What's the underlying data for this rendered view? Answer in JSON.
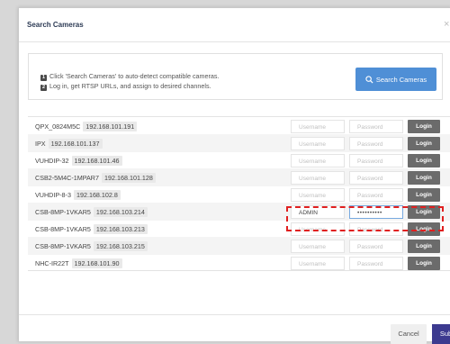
{
  "dialog": {
    "title": "Search Cameras",
    "close_label": "×",
    "steps": [
      {
        "num": "1",
        "text": "Click 'Search Cameras' to auto-detect compatible cameras."
      },
      {
        "num": "2",
        "text": "Log in, get RTSP URLs, and assign to desired channels."
      }
    ],
    "search_button_label": "Search Cameras",
    "search_icon": "search-icon",
    "cancel_label": "Cancel",
    "submit_label": "Submit"
  },
  "fields": {
    "username_placeholder": "Username",
    "password_placeholder": "Password",
    "login_label": "Login"
  },
  "cameras": [
    {
      "name": "QPX_0824M5C",
      "ip": "192.168.101.191"
    },
    {
      "name": "IPX",
      "ip": "192.168.101.137"
    },
    {
      "name": "VUHDIP-32",
      "ip": "192.168.101.46"
    },
    {
      "name": "CSB2-5M4C-1MPAR7",
      "ip": "192.168.101.128"
    },
    {
      "name": "VUHDIP-8-3",
      "ip": "192.168.102.8"
    },
    {
      "name": "CSB-8MP-1VKAR5",
      "ip": "192.168.103.214",
      "username": "ADMIN",
      "password": "••••••••••"
    },
    {
      "name": "CSB-8MP-1VKAR5",
      "ip": "192.168.103.213"
    },
    {
      "name": "CSB-8MP-1VKAR5",
      "ip": "192.168.103.215"
    },
    {
      "name": "NHC-IR22T",
      "ip": "192.168.101.90"
    }
  ],
  "colors": {
    "search_button": "#4f8fd6",
    "submit_button": "#3c3a8f",
    "login_button": "#6b6b6b",
    "highlight": "#e02020"
  }
}
